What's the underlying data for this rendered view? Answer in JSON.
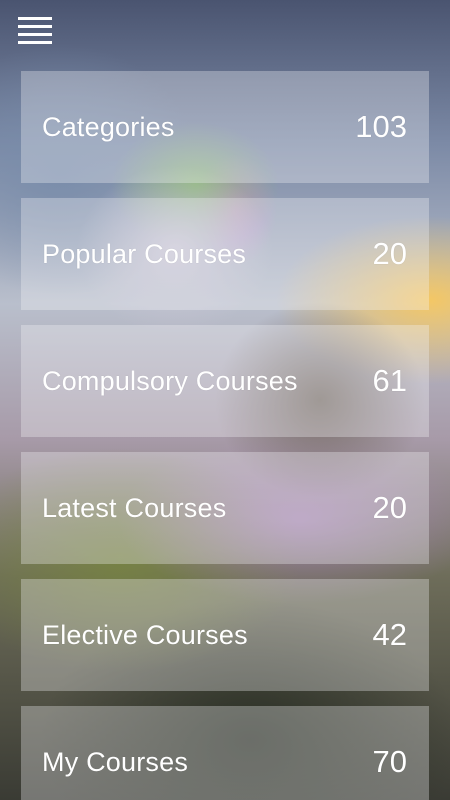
{
  "header": {
    "menu_icon": "hamburger-menu-icon"
  },
  "menu": {
    "items": [
      {
        "label": "Categories",
        "count": "103"
      },
      {
        "label": "Popular Courses",
        "count": "20"
      },
      {
        "label": "Compulsory Courses",
        "count": "61"
      },
      {
        "label": "Latest Courses",
        "count": "20"
      },
      {
        "label": "Elective Courses",
        "count": "42"
      },
      {
        "label": "My Courses",
        "count": "70"
      }
    ]
  },
  "colors": {
    "text": "#ffffff",
    "card_background": "rgba(245,245,250,0.32)"
  }
}
